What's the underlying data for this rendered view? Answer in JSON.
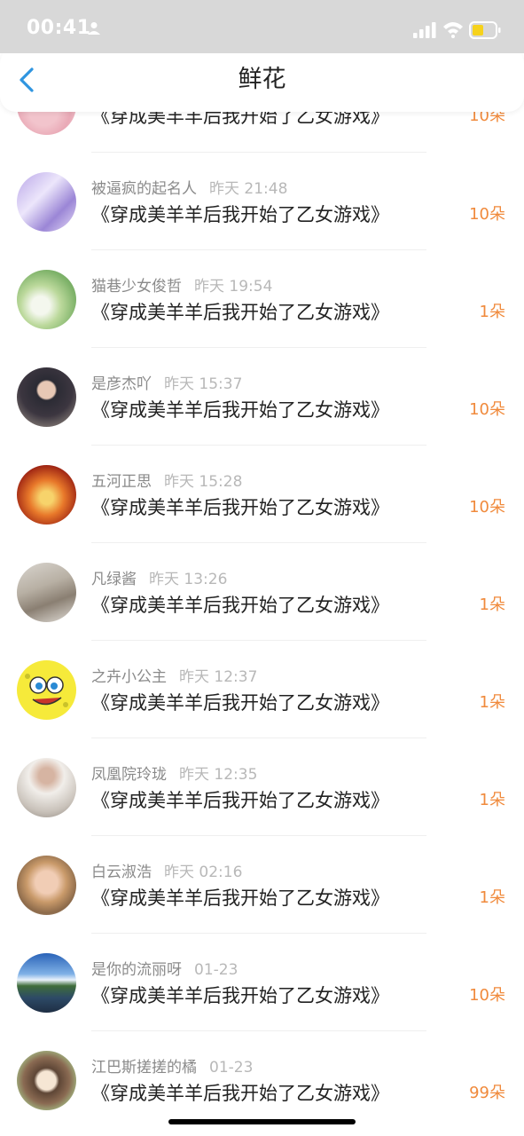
{
  "status_bar": {
    "time": "00:41"
  },
  "header": {
    "title": "鲜花"
  },
  "colors": {
    "accent": "#f08a3c",
    "back_arrow": "#2f95e0"
  },
  "partial_row": {
    "title": "《穿成美羊羊后我开始了乙女游戏》",
    "count": "10朵"
  },
  "items": [
    {
      "name": "被逼疯的起名人",
      "time": "昨天 21:48",
      "title": "《穿成美羊羊后我开始了乙女游戏》",
      "count": "10朵"
    },
    {
      "name": "猫巷少女俊哲",
      "time": "昨天 19:54",
      "title": "《穿成美羊羊后我开始了乙女游戏》",
      "count": "1朵"
    },
    {
      "name": "是彦杰吖",
      "time": "昨天 15:37",
      "title": "《穿成美羊羊后我开始了乙女游戏》",
      "count": "10朵"
    },
    {
      "name": "五河正思",
      "time": "昨天 15:28",
      "title": "《穿成美羊羊后我开始了乙女游戏》",
      "count": "10朵"
    },
    {
      "name": "凡绿酱",
      "time": "昨天 13:26",
      "title": "《穿成美羊羊后我开始了乙女游戏》",
      "count": "1朵"
    },
    {
      "name": "之卉小公主",
      "time": "昨天 12:37",
      "title": "《穿成美羊羊后我开始了乙女游戏》",
      "count": "1朵"
    },
    {
      "name": "凤凰院玲珑",
      "time": "昨天 12:35",
      "title": "《穿成美羊羊后我开始了乙女游戏》",
      "count": "1朵"
    },
    {
      "name": "白云淑浩",
      "time": "昨天 02:16",
      "title": "《穿成美羊羊后我开始了乙女游戏》",
      "count": "1朵"
    },
    {
      "name": "是你的流丽呀",
      "time": "01-23",
      "title": "《穿成美羊羊后我开始了乙女游戏》",
      "count": "10朵"
    },
    {
      "name": "江巴斯搓搓的橘",
      "time": "01-23",
      "title": "《穿成美羊羊后我开始了乙女游戏》",
      "count": "99朵"
    }
  ]
}
